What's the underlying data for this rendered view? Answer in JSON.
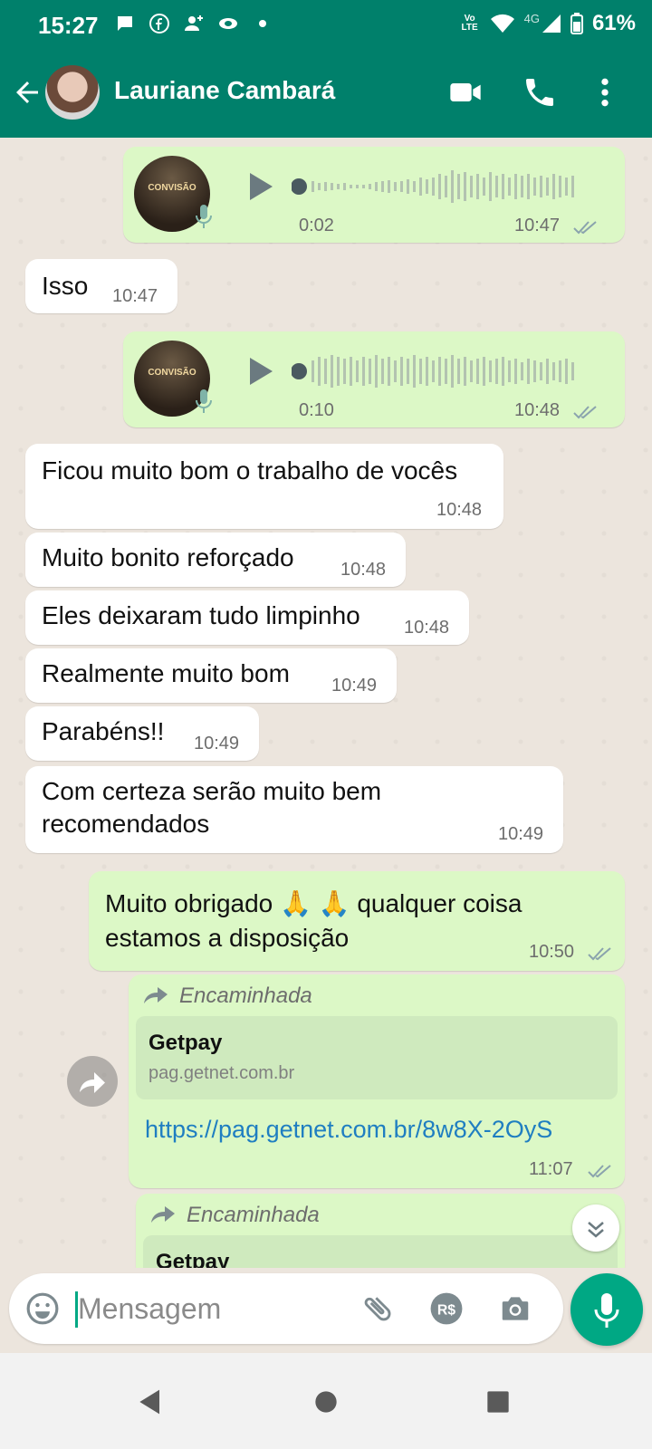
{
  "status_bar": {
    "time": "15:27",
    "battery": "61%",
    "network": "4G",
    "volte": "Vo LTE"
  },
  "header": {
    "contact_name": "Lauriane Cambará"
  },
  "messages": {
    "voice1": {
      "duration": "0:02",
      "time": "10:47",
      "brand": "CONVISÃO"
    },
    "isso": {
      "text": "Isso",
      "time": "10:47"
    },
    "voice2": {
      "duration": "0:10",
      "time": "10:48",
      "brand": "CONVISÃO"
    },
    "m1": {
      "text": "Ficou muito bom o trabalho de vocês",
      "time": "10:48"
    },
    "m2": {
      "text": "Muito bonito reforçado",
      "time": "10:48"
    },
    "m3": {
      "text": "Eles deixaram tudo limpinho",
      "time": "10:48"
    },
    "m4": {
      "text": "Realmente muito bom",
      "time": "10:49"
    },
    "m5": {
      "text": "Parabéns!!",
      "time": "10:49"
    },
    "m6": {
      "line1": "Com certeza serão muito bem",
      "line2": "recomendados",
      "time": "10:49"
    },
    "out1": {
      "line1_a": "Muito obrigado",
      "emoji": "🙏 🙏",
      "line1_b": "qualquer coisa",
      "line2": "estamos a disposição",
      "time": "10:50"
    },
    "fwd1": {
      "label": "Encaminhada",
      "card_title": "Getpay",
      "card_domain": "pag.getnet.com.br",
      "url": "https://pag.getnet.com.br/8w8X-2OyS",
      "time": "11:07"
    },
    "fwd2": {
      "label": "Encaminhada",
      "card_title": "Getpay"
    }
  },
  "composer": {
    "placeholder": "Mensagem"
  },
  "colors": {
    "header": "#00806b",
    "outgoing_bubble": "#dcf8c6",
    "incoming_bubble": "#ffffff",
    "accent": "#00a884",
    "link": "#1f7ec1",
    "read_ticks": "#8aa3ad"
  },
  "icons": [
    "back-arrow-icon",
    "video-call-icon",
    "phone-icon",
    "more-vert-icon",
    "play-icon",
    "mic-icon",
    "double-check-icon",
    "forward-icon",
    "share-icon",
    "chevron-double-down-icon",
    "emoji-icon",
    "attach-icon",
    "payment-icon",
    "camera-icon",
    "nav-back-icon",
    "nav-home-icon",
    "nav-recents-icon"
  ]
}
